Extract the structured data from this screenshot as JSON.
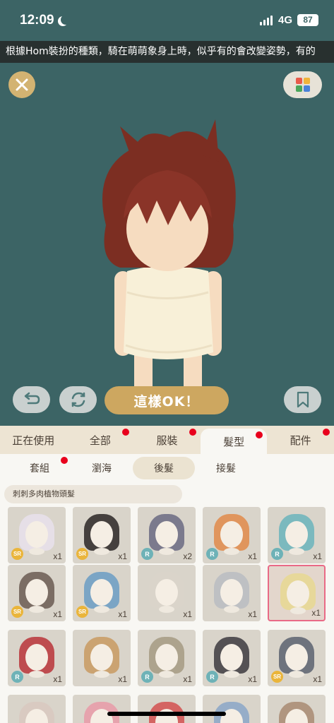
{
  "status_bar": {
    "time": "12:09",
    "network": "4G",
    "battery": "87"
  },
  "ticker": {
    "text": "根據Hom裝扮的種類，騎在萌萌象身上時，似乎有的會改變姿勢，有的"
  },
  "scene": {
    "close_icon": "close-icon",
    "grid_icon": "color-grid-icon",
    "ok_label": "這樣OK！",
    "undo_icon": "undo-icon",
    "rotate_icon": "rotate-icon",
    "bookmark_icon": "bookmark-icon",
    "background_color": "#3c6465"
  },
  "tabs": [
    {
      "label": "正在使用",
      "dot": false,
      "active": false
    },
    {
      "label": "全部",
      "dot": true,
      "active": false
    },
    {
      "label": "服裝",
      "dot": true,
      "active": false
    },
    {
      "label": "髮型",
      "dot": true,
      "active": true
    },
    {
      "label": "配件",
      "dot": true,
      "active": false
    }
  ],
  "subtabs": [
    {
      "label": "套組",
      "dot": true,
      "active": false
    },
    {
      "label": "瀏海",
      "dot": false,
      "active": false
    },
    {
      "label": "後髮",
      "dot": false,
      "active": true
    },
    {
      "label": "接髮",
      "dot": false,
      "active": false
    }
  ],
  "selected_item_name": "刺刺多肉植物頭髮",
  "items": [
    {
      "rarity": "SR",
      "qty": "x1",
      "hair_color": "#e8e0ec"
    },
    {
      "rarity": "SR",
      "qty": "x1",
      "hair_color": "#2a2626"
    },
    {
      "rarity": "R",
      "qty": "x2",
      "hair_color": "#6a6a82"
    },
    {
      "rarity": "R",
      "qty": "x1",
      "hair_color": "#e08a4a"
    },
    {
      "rarity": "R",
      "qty": "x1",
      "hair_color": "#6ab4bc"
    },
    {
      "rarity": "SR",
      "qty": "x1",
      "hair_color": "#6a5a52"
    },
    {
      "rarity": "SR",
      "qty": "x1",
      "hair_color": "#6a9cc4"
    },
    {
      "rarity": "",
      "qty": "x1",
      "hair_color": "#d9d4ca"
    },
    {
      "rarity": "",
      "qty": "x1",
      "hair_color": "#b8bcc2"
    },
    {
      "rarity": "",
      "qty": "x1",
      "hair_color": "#e8d890",
      "selected": true
    },
    {
      "rarity": "R",
      "qty": "x1",
      "hair_color": "#b8343a"
    },
    {
      "rarity": "",
      "qty": "x1",
      "hair_color": "#c89a62"
    },
    {
      "rarity": "R",
      "qty": "x1",
      "hair_color": "#a49a82"
    },
    {
      "rarity": "R",
      "qty": "x1",
      "hair_color": "#3c3a40"
    },
    {
      "rarity": "SR",
      "qty": "x1",
      "hair_color": "#5a6270"
    },
    {
      "rarity": "",
      "qty": "",
      "hair_color": "#d8c8c0"
    },
    {
      "rarity": "",
      "qty": "",
      "hair_color": "#e89aa8"
    },
    {
      "rarity": "",
      "qty": "",
      "hair_color": "#d25050"
    },
    {
      "rarity": "",
      "qty": "",
      "hair_color": "#8aa6c8"
    },
    {
      "rarity": "",
      "qty": "",
      "hair_color": "#a88a72"
    }
  ]
}
